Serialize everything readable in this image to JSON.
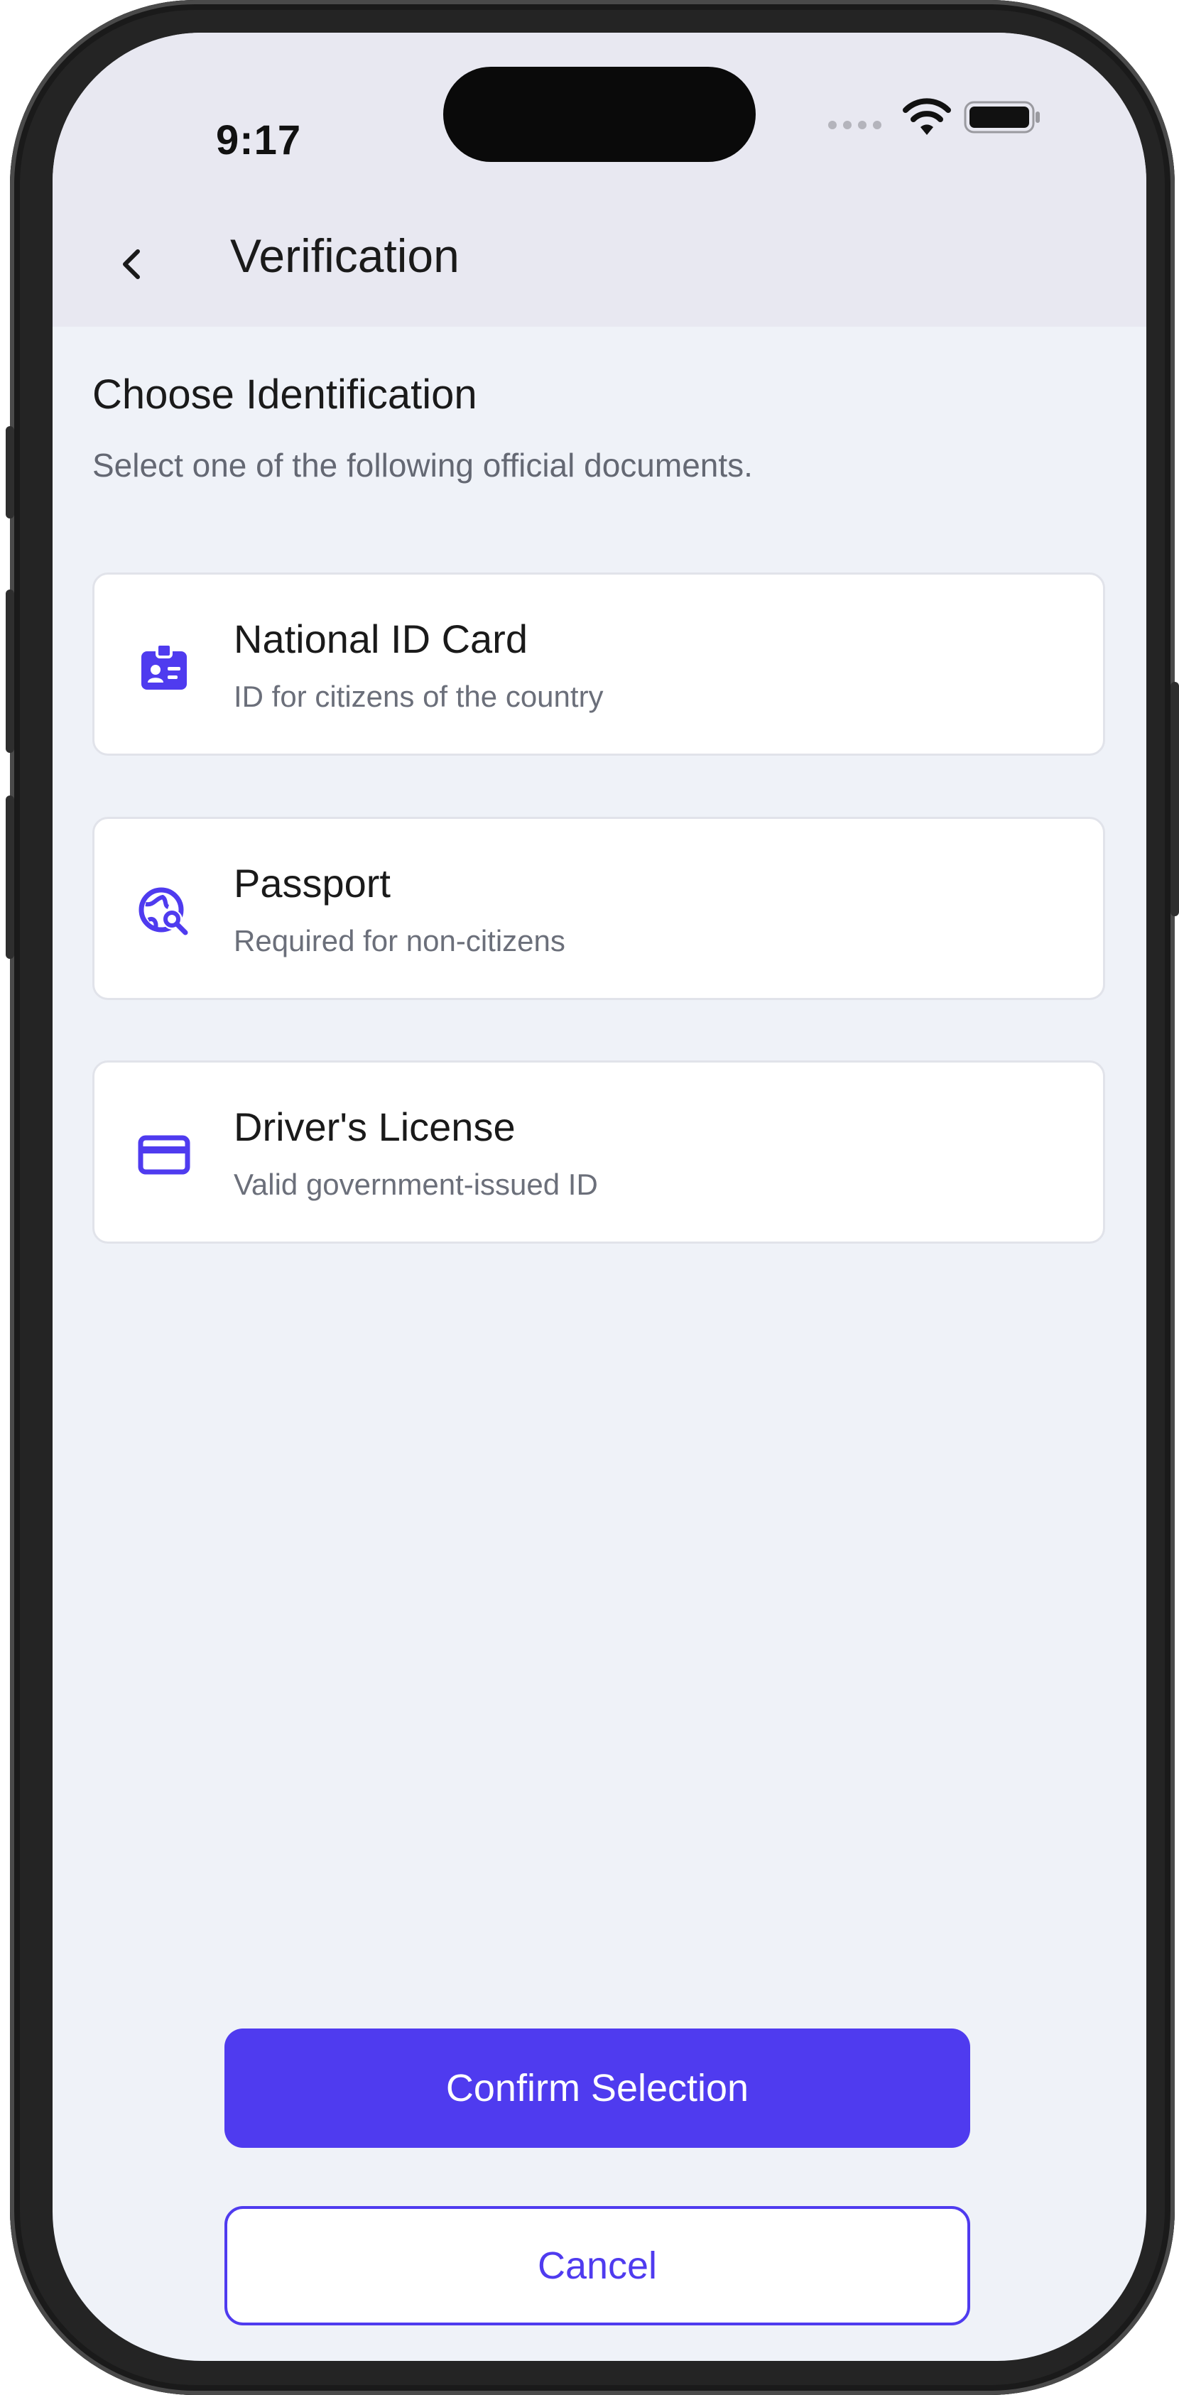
{
  "status_bar": {
    "time": "9:17"
  },
  "header": {
    "title": "Verification",
    "back_icon": "chevron-left-icon"
  },
  "section": {
    "title": "Choose Identification",
    "subtitle": "Select one of the following official documents."
  },
  "options": [
    {
      "title": "National ID Card",
      "subtitle": "ID for citizens of the country",
      "icon": "id-badge-icon"
    },
    {
      "title": "Passport",
      "subtitle": "Required for non-citizens",
      "icon": "globe-search-icon"
    },
    {
      "title": "Driver's License",
      "subtitle": "Valid government-issued ID",
      "icon": "credit-card-icon"
    }
  ],
  "actions": {
    "confirm_label": "Confirm Selection",
    "cancel_label": "Cancel"
  },
  "colors": {
    "accent": "#4f3bef",
    "header_bg": "#e8e8f1",
    "screen_bg": "#eff2f8",
    "card_bg": "#ffffff"
  }
}
